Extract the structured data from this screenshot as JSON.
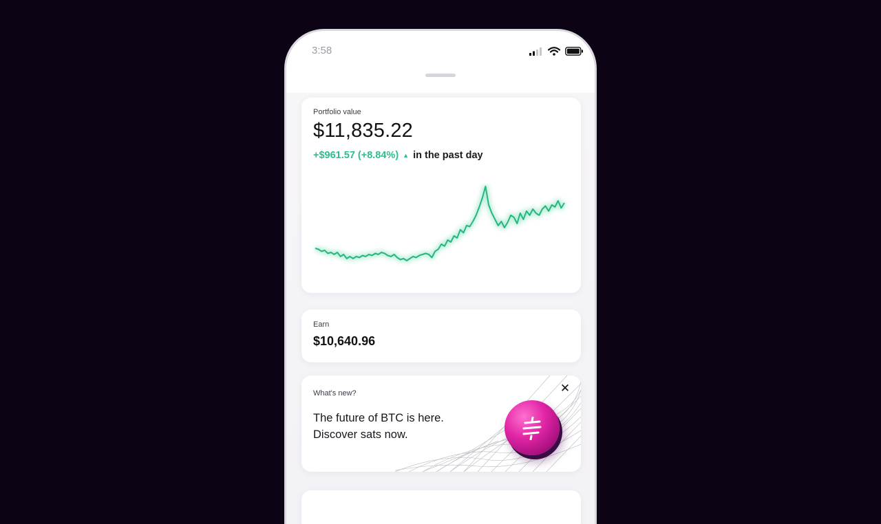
{
  "status_bar": {
    "time": "3:58",
    "icons": [
      "signal-icon",
      "wifi-icon",
      "battery-icon"
    ]
  },
  "portfolio": {
    "label": "Portfolio value",
    "value": "$11,835.22",
    "change": "+$961.57 (+8.84%)",
    "change_direction": "up",
    "period": "in the past day",
    "accent_color": "#2dbf8a"
  },
  "chart_data": {
    "type": "line",
    "series": [
      {
        "values": [
          58,
          57,
          55,
          56,
          53,
          54,
          52,
          54,
          50,
          52,
          48,
          50,
          48,
          50,
          49,
          51,
          50,
          52,
          51,
          53,
          52,
          54,
          53,
          51,
          50,
          52,
          49,
          47,
          48,
          46,
          48,
          50,
          49,
          51,
          52,
          53,
          52,
          49,
          55,
          57,
          62,
          60,
          66,
          64,
          70,
          68,
          76,
          73,
          80,
          79,
          84,
          90,
          98,
          107,
          118,
          100,
          92,
          86,
          80,
          84,
          78,
          83,
          90,
          88,
          82,
          92,
          86,
          94,
          90,
          96,
          92,
          90,
          96,
          99,
          94,
          100,
          98,
          104,
          97,
          102
        ]
      }
    ]
  },
  "earn": {
    "label": "Earn",
    "value": "$10,640.96"
  },
  "whats_new": {
    "label": "What's new?",
    "headline_line1": "The future of BTC is here.",
    "headline_line2": "Discover sats now.",
    "close_icon": "close-icon",
    "coin_color": "#e226a6"
  }
}
